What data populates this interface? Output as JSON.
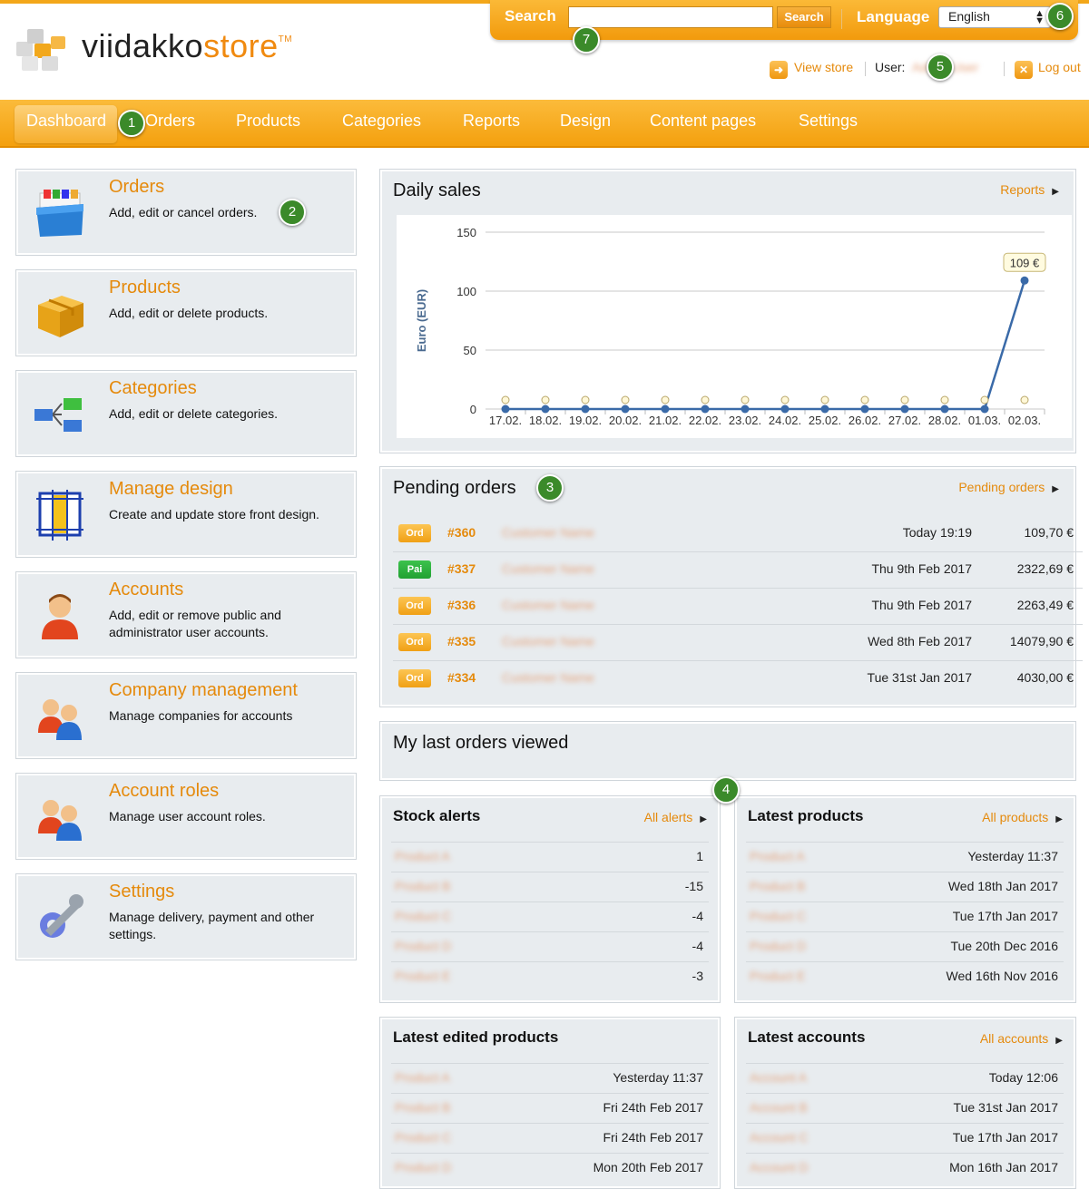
{
  "brand": {
    "name_part1": "viidakko",
    "name_part2": "store",
    "tm": "TM"
  },
  "search": {
    "label": "Search",
    "placeholder": "",
    "button": "Search"
  },
  "language": {
    "label": "Language",
    "selected": "English"
  },
  "userbar": {
    "view_store": "View store",
    "user_label": "User:",
    "user_name": "Admin User",
    "logout": "Log out"
  },
  "nav": {
    "items": [
      "Dashboard",
      "Orders",
      "Products",
      "Categories",
      "Reports",
      "Design",
      "Content pages",
      "Settings"
    ]
  },
  "cards": [
    {
      "title": "Orders",
      "desc": "Add, edit or cancel orders."
    },
    {
      "title": "Products",
      "desc": "Add, edit or delete products."
    },
    {
      "title": "Categories",
      "desc": "Add, edit or delete categories."
    },
    {
      "title": "Manage design",
      "desc": "Create and update store front design."
    },
    {
      "title": "Accounts",
      "desc": "Add, edit or remove public and administrator user accounts."
    },
    {
      "title": "Company management",
      "desc": "Manage companies for accounts"
    },
    {
      "title": "Account roles",
      "desc": "Manage user account roles."
    },
    {
      "title": "Settings",
      "desc": "Manage delivery, payment and other settings."
    }
  ],
  "daily_sales": {
    "title": "Daily sales",
    "link": "Reports",
    "tooltip": "109 €"
  },
  "chart_data": {
    "type": "line",
    "title": "",
    "ylabel": "Euro (EUR)",
    "xlabel": "",
    "ylim": [
      0,
      150
    ],
    "yticks": [
      0,
      50,
      100,
      150
    ],
    "grid": true,
    "categories": [
      "17.02.",
      "18.02.",
      "19.02.",
      "20.02.",
      "21.02.",
      "22.02.",
      "23.02.",
      "24.02.",
      "25.02.",
      "26.02.",
      "27.02.",
      "28.02.",
      "01.03.",
      "02.03."
    ],
    "series": [
      {
        "values": [
          0,
          0,
          0,
          0,
          0,
          0,
          0,
          0,
          0,
          0,
          0,
          0,
          0,
          109
        ]
      }
    ]
  },
  "pending": {
    "title": "Pending orders",
    "link": "Pending orders",
    "rows": [
      {
        "badge": "Ord",
        "num": "#360",
        "name": "Customer Name",
        "date": "Today 19:19",
        "amount": "109,70 €"
      },
      {
        "badge": "Pai",
        "num": "#337",
        "name": "Customer Name",
        "date": "Thu 9th Feb 2017",
        "amount": "2322,69 €"
      },
      {
        "badge": "Ord",
        "num": "#336",
        "name": "Customer Name",
        "date": "Thu 9th Feb 2017",
        "amount": "2263,49 €"
      },
      {
        "badge": "Ord",
        "num": "#335",
        "name": "Customer Name",
        "date": "Wed 8th Feb 2017",
        "amount": "14079,90 €"
      },
      {
        "badge": "Ord",
        "num": "#334",
        "name": "Customer Name",
        "date": "Tue 31st Jan 2017",
        "amount": "4030,00 €"
      }
    ]
  },
  "last_viewed": {
    "title": "My last orders viewed"
  },
  "stock_alerts": {
    "title": "Stock alerts",
    "link": "All alerts",
    "rows": [
      {
        "name": "Product A",
        "value": "1"
      },
      {
        "name": "Product B",
        "value": "-15"
      },
      {
        "name": "Product C",
        "value": "-4"
      },
      {
        "name": "Product D",
        "value": "-4"
      },
      {
        "name": "Product E",
        "value": "-3"
      }
    ]
  },
  "latest_products": {
    "title": "Latest products",
    "link": "All products",
    "rows": [
      {
        "name": "Product A",
        "value": "Yesterday 11:37"
      },
      {
        "name": "Product B",
        "value": "Wed 18th Jan 2017"
      },
      {
        "name": "Product C",
        "value": "Tue 17th Jan 2017"
      },
      {
        "name": "Product D",
        "value": "Tue 20th Dec 2016"
      },
      {
        "name": "Product E",
        "value": "Wed 16th Nov 2016"
      }
    ]
  },
  "latest_edited": {
    "title": "Latest edited products",
    "rows": [
      {
        "name": "Product A",
        "value": "Yesterday 11:37"
      },
      {
        "name": "Product B",
        "value": "Fri 24th Feb 2017"
      },
      {
        "name": "Product C",
        "value": "Fri 24th Feb 2017"
      },
      {
        "name": "Product D",
        "value": "Mon 20th Feb 2017"
      }
    ]
  },
  "latest_accounts": {
    "title": "Latest accounts",
    "link": "All accounts",
    "rows": [
      {
        "name": "Account A",
        "value": "Today 12:06"
      },
      {
        "name": "Account B",
        "value": "Tue 31st Jan 2017"
      },
      {
        "name": "Account C",
        "value": "Tue 17th Jan 2017"
      },
      {
        "name": "Account D",
        "value": "Mon 16th Jan 2017"
      }
    ]
  },
  "callouts": [
    "1",
    "2",
    "3",
    "4",
    "5",
    "6",
    "7"
  ],
  "colors": {
    "accent": "#f4a00e",
    "link": "#e58a0c",
    "panel": "#e8ecef",
    "callout": "#3b8a2a",
    "line": "#3a6aa8"
  }
}
